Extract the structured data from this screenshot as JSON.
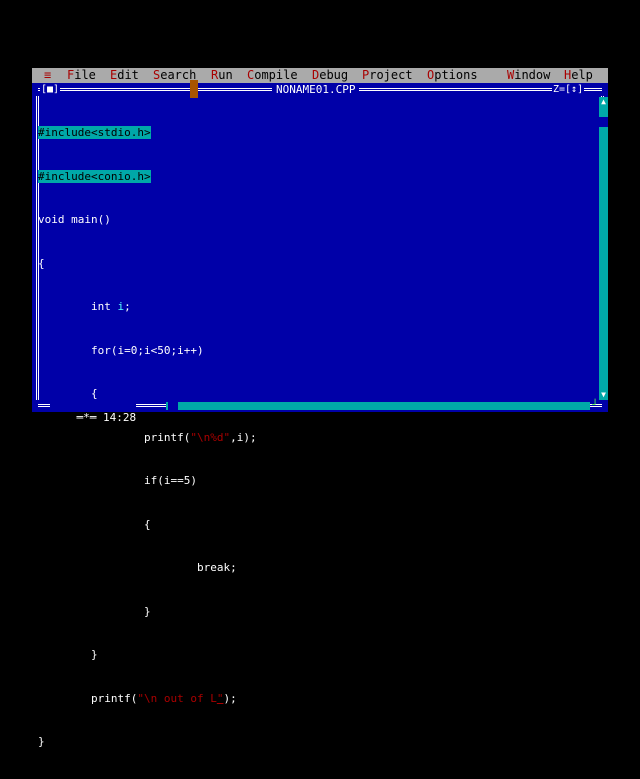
{
  "menu": {
    "system_glyph": "≡",
    "items": [
      {
        "hot": "F",
        "rest": "ile"
      },
      {
        "hot": "E",
        "rest": "dit"
      },
      {
        "hot": "S",
        "rest": "earch"
      },
      {
        "hot": "R",
        "rest": "un"
      },
      {
        "hot": "C",
        "rest": "ompile"
      },
      {
        "hot": "D",
        "rest": "ebug"
      },
      {
        "hot": "P",
        "rest": "roject"
      },
      {
        "hot": "O",
        "rest": "ptions"
      },
      {
        "hot": "W",
        "rest": "indow"
      },
      {
        "hot": "H",
        "rest": "elp"
      }
    ]
  },
  "window": {
    "title": "NONAME01.CPP",
    "close_box": "[■]",
    "window_number": "Z=[↕]",
    "cursor_position": "14:28"
  },
  "code": {
    "line1": "#include<stdio.h>",
    "line2": "#include<conio.h>",
    "line3": "void main()",
    "line4": "{",
    "line5_kw": "int ",
    "line5_var": "i",
    "line5_end": ";",
    "line6": "for(i=0;i<50;i++)",
    "line7": "{",
    "line8_fn": "printf(",
    "line8_str": "\"\\n%d\"",
    "line8_end": ",i);",
    "line9": "if(i==5)",
    "line10": "{",
    "line11": "break;",
    "line12": "}",
    "line13": "}",
    "line14_fn": "printf(",
    "line14_str": "\"\\n out of L",
    "line14_cursor": "\"",
    "line14_end": ");",
    "line15": "}"
  },
  "colors": {
    "editor_bg": "#0000a8",
    "menu_bg": "#aaaaaa",
    "hotkey": "#a80000",
    "scrollbar": "#00a8a8"
  }
}
